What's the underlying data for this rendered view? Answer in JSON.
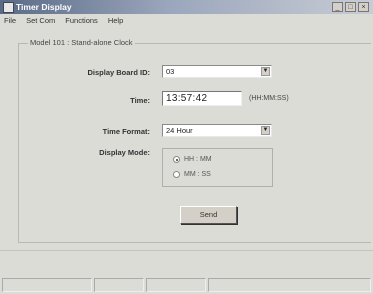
{
  "window": {
    "title": "Timer Display",
    "controls": [
      "_",
      "□",
      "×"
    ]
  },
  "menu": {
    "items": [
      "File",
      "Set Com",
      "Functions",
      "Help"
    ]
  },
  "group": {
    "label": "Model 101 : Stand-alone Clock"
  },
  "form": {
    "display_board_id": {
      "label": "Display Board ID:",
      "value": "03"
    },
    "time": {
      "label": "Time:",
      "value": "13:57:42",
      "hint": "(HH:MM:SS)"
    },
    "time_format": {
      "label": "Time Format:",
      "value": "24 Hour"
    },
    "display_mode": {
      "label": "Display Mode:",
      "options": [
        {
          "label": "HH : MM",
          "selected": true
        },
        {
          "label": "MM : SS",
          "selected": false
        }
      ]
    },
    "send_label": "Send"
  },
  "icons": {
    "dropdown": "chevron-down-icon",
    "app": "window-app-icon"
  }
}
